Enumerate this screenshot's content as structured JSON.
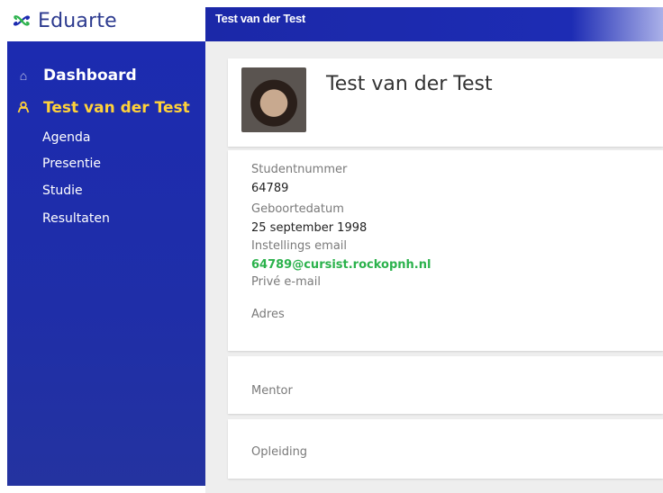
{
  "app": {
    "logo_text": "Eduarte",
    "header_title": "Test van der Test"
  },
  "sidebar": {
    "dashboard": "Dashboard",
    "student": "Test van der Test",
    "items": [
      {
        "label": "Agenda"
      },
      {
        "label": "Presentie"
      },
      {
        "label": "Studie"
      },
      {
        "label": "Resultaten"
      }
    ]
  },
  "profile": {
    "name": "Test van der Test"
  },
  "info": {
    "studentnummer_label": "Studentnummer",
    "studentnummer_value": "64789",
    "geboortedatum_label": "Geboortedatum",
    "geboortedatum_value": "25 september 1998",
    "email_label": "Instellings email",
    "email_value": "64789@cursist.rockopnh.nl",
    "prive_label": "Privé e-mail",
    "adres_label": "Adres"
  },
  "sections": {
    "mentor": "Mentor",
    "opleiding": "Opleiding"
  },
  "colors": {
    "sidebar": "#1f2ea8",
    "active": "#ffd23a",
    "link": "#2bb24c"
  },
  "icons": {
    "logo": "eduarte-logo-icon",
    "dashboard": "home-icon",
    "student": "user-icon"
  }
}
